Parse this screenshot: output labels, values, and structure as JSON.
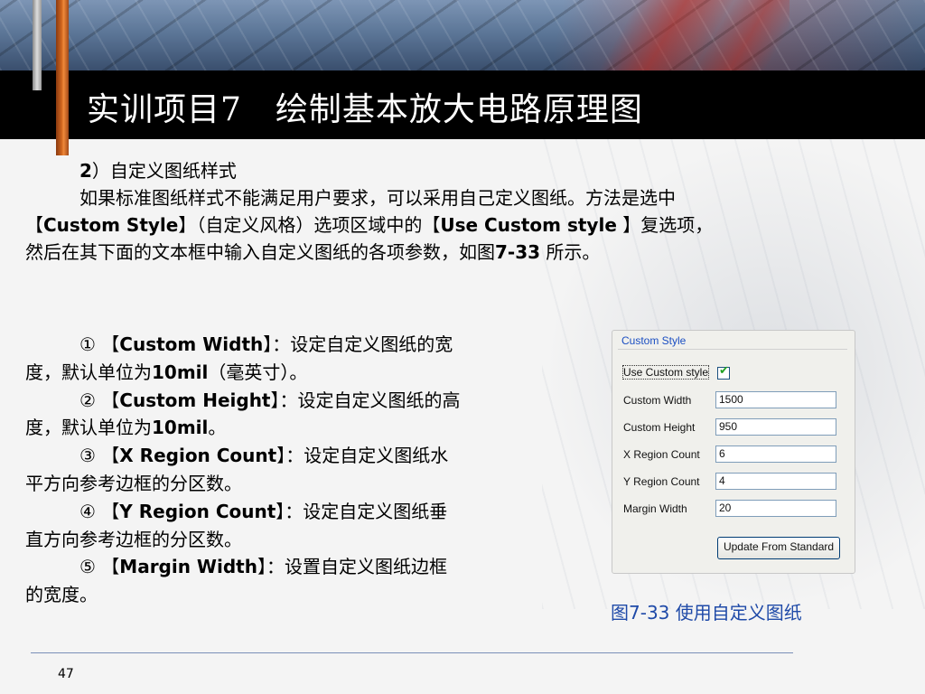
{
  "slide": {
    "title": "实训项目7　绘制基本放大电路原理图",
    "intro": {
      "heading_num": "2",
      "heading_text": "）自定义图纸样式",
      "line1": "如果标准图纸样式不能满足用户要求，可以采用自己定义图纸。方法是选中",
      "line2_a": "【",
      "line2_b": "Custom Style",
      "line2_c": "】（自定义风格）选项区域中的【",
      "line2_d": "Use Custom style",
      "line2_e": " 】复选项，",
      "line3_a": "然后在其下面的文本框中输入自定义图纸的各项参数，如图",
      "line3_b": "7-33",
      "line3_c": " 所示。"
    },
    "items": [
      {
        "num": "①",
        "open": " 【",
        "key": "Custom Width",
        "rest": "】：设定自定义图纸的宽",
        "cont_a": "度，默认单位为",
        "cont_b": "10mil",
        "cont_c": "（毫英寸）。"
      },
      {
        "num": "②",
        "open": " 【",
        "key": "Custom Height",
        "rest": "】：设定自定义图纸的高",
        "cont_a": "度，默认单位为",
        "cont_b": "10mil",
        "cont_c": "。"
      },
      {
        "num": "③",
        "open": " 【",
        "key": "X Region Count",
        "rest": "】：设定自定义图纸水",
        "cont_a": "平方向参考边框的分区数。",
        "cont_b": "",
        "cont_c": ""
      },
      {
        "num": "④",
        "open": " 【",
        "key": "Y Region Count",
        "rest": "】：设定自定义图纸垂",
        "cont_a": "直方向参考边框的分区数。",
        "cont_b": "",
        "cont_c": ""
      },
      {
        "num": "⑤",
        "open": " 【",
        "key": "Margin Width",
        "rest": "】：设置自定义图纸边框",
        "cont_a": "的宽度。",
        "cont_b": "",
        "cont_c": ""
      }
    ],
    "caption": "图7-33 使用自定义图纸",
    "page_number": "47"
  },
  "dialog": {
    "group_title": "Custom Style",
    "use_custom_label": "Use Custom style",
    "use_custom_checked": true,
    "fields": [
      {
        "label": "Custom Width",
        "value": "1500"
      },
      {
        "label": "Custom Height",
        "value": "950"
      },
      {
        "label": "X Region Count",
        "value": "6"
      },
      {
        "label": "Y Region Count",
        "value": "4"
      },
      {
        "label": "Margin Width",
        "value": "20"
      }
    ],
    "button_label": "Update From Standard"
  },
  "colors": {
    "title_bar": "#000000",
    "title_text": "#ffffff",
    "caption_text": "#1f4aa8",
    "dialog_link_blue": "#1a4ec2",
    "accent_orange": "#d0661e"
  },
  "icons": [
    "check-icon"
  ]
}
